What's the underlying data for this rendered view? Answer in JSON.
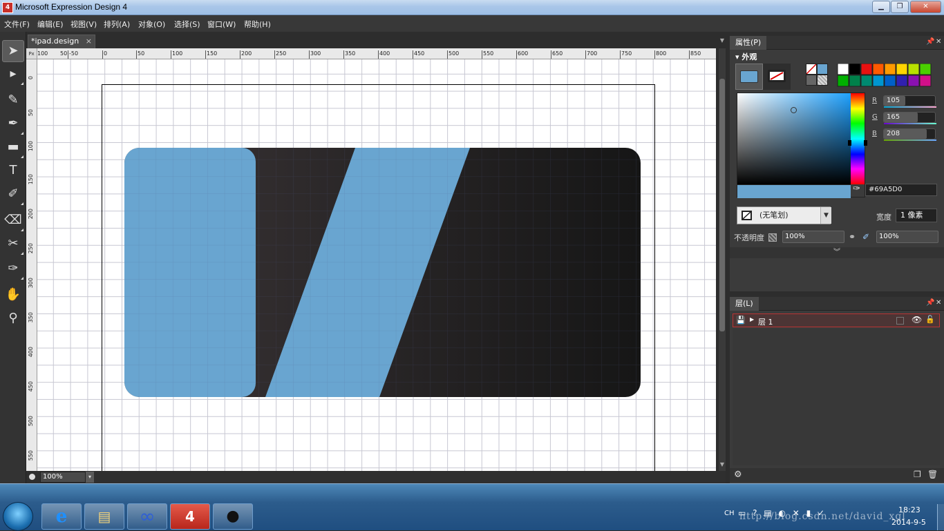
{
  "window": {
    "title": "Microsoft Expression Design 4",
    "icon_text": "4"
  },
  "menu": [
    {
      "label": "文件(F)"
    },
    {
      "label": "编辑(E)"
    },
    {
      "label": "视图(V)"
    },
    {
      "label": "排列(A)"
    },
    {
      "label": "对象(O)"
    },
    {
      "label": "选择(S)"
    },
    {
      "label": "窗口(W)"
    },
    {
      "label": "帮助(H)"
    }
  ],
  "document": {
    "tab_label": "*ipad.design",
    "tab_close": "×"
  },
  "ruler": {
    "unit": "Px",
    "h_ticks": [
      "100",
      "50",
      "-50",
      "0",
      "50",
      "100",
      "150",
      "200",
      "250",
      "300",
      "350",
      "400",
      "450",
      "500",
      "550",
      "600",
      "650",
      "700",
      "750",
      "800",
      "850"
    ],
    "v_ticks": [
      "0",
      "50",
      "100",
      "150",
      "200",
      "250",
      "300",
      "350",
      "400",
      "450",
      "500",
      "550"
    ]
  },
  "status": {
    "zoom": "100%"
  },
  "artwork": {
    "fill_color": "#69A5D0",
    "dark_color": "#3a3436",
    "darkest_color": "#181818"
  },
  "properties": {
    "panel_title": "属性(P)",
    "section": "▾ 外观",
    "color": {
      "r": "105",
      "g": "165",
      "b": "208",
      "hex": "#69A5D0",
      "r_label": "R",
      "g_label": "G",
      "b_label": "B"
    },
    "swatches": [
      "#ffffff",
      "#000000",
      "#e81010",
      "#ff5a00",
      "#ff9a00",
      "#ffd400",
      "#b8e000",
      "#4ad000",
      "#00b000",
      "#00804a",
      "#008a70",
      "#0096d0",
      "#0060c8",
      "#3020b0",
      "#8a10b0",
      "#d0108a"
    ],
    "stroke_option": "(无笔划)",
    "width_label": "宽度",
    "width_value": "1 像素",
    "opacity_label": "不透明度",
    "opacity_value": "100%",
    "effect_opacity_value": "100%"
  },
  "layers": {
    "panel_title": "层(L)",
    "layer_name": "层 1"
  },
  "taskbar": {
    "apps": [
      {
        "name": "internet-explorer",
        "glyph": "e"
      },
      {
        "name": "file-explorer",
        "glyph": "▤"
      },
      {
        "name": "expression-blend",
        "glyph": "∞"
      },
      {
        "name": "expression-design",
        "glyph": "4"
      },
      {
        "name": "qq",
        "glyph": "●"
      }
    ],
    "lang": "CH",
    "time": "18:23",
    "date": "2014-9-5",
    "watermark": "http://blog.csdn.net/david_xgl"
  }
}
